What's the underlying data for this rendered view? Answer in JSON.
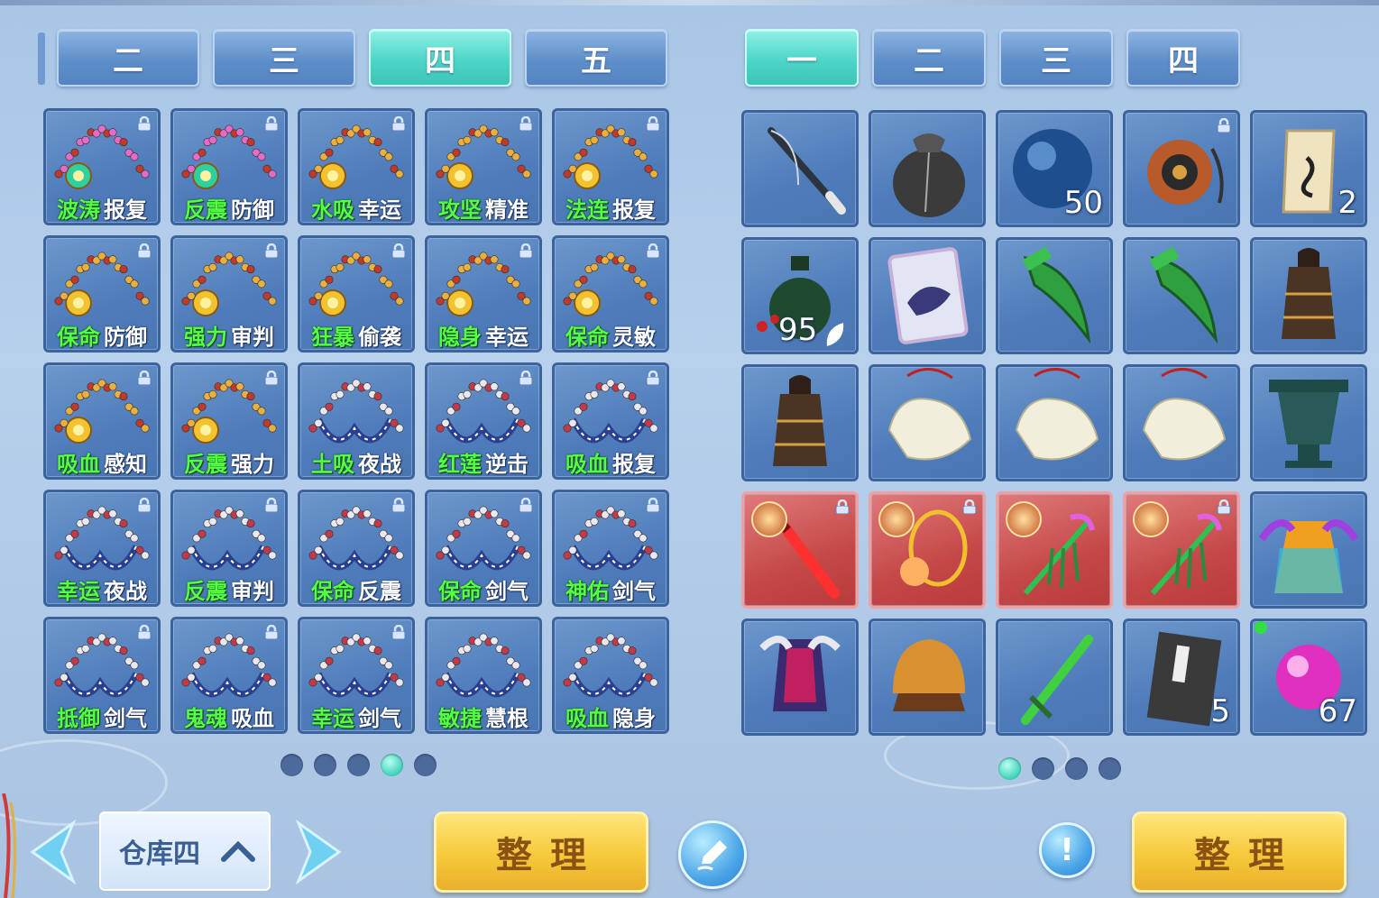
{
  "left_panel": {
    "tabs": [
      {
        "label": "二",
        "active": false
      },
      {
        "label": "三",
        "active": false
      },
      {
        "label": "四",
        "active": true
      },
      {
        "label": "五",
        "active": false
      }
    ],
    "items": [
      {
        "a": "波涛",
        "b": "报复",
        "kind": "necklace-a",
        "locked": true
      },
      {
        "a": "反震",
        "b": "防御",
        "kind": "necklace-a",
        "locked": true
      },
      {
        "a": "水吸",
        "b": "幸运",
        "kind": "necklace-b",
        "locked": true
      },
      {
        "a": "攻坚",
        "b": "精准",
        "kind": "necklace-b",
        "locked": true
      },
      {
        "a": "法连",
        "b": "报复",
        "kind": "necklace-b",
        "locked": true
      },
      {
        "a": "保命",
        "b": "防御",
        "kind": "necklace-b",
        "locked": true
      },
      {
        "a": "强力",
        "b": "审判",
        "kind": "necklace-b",
        "locked": true
      },
      {
        "a": "狂暴",
        "b": "偷袭",
        "kind": "necklace-b",
        "locked": true
      },
      {
        "a": "隐身",
        "b": "幸运",
        "kind": "necklace-b",
        "locked": true
      },
      {
        "a": "保命",
        "b": "灵敏",
        "kind": "necklace-b",
        "locked": true
      },
      {
        "a": "吸血",
        "b": "感知",
        "kind": "necklace-b",
        "locked": true
      },
      {
        "a": "反震",
        "b": "强力",
        "kind": "necklace-b",
        "locked": true
      },
      {
        "a": "土吸",
        "b": "夜战",
        "kind": "necklace-c",
        "locked": false
      },
      {
        "a": "红莲",
        "b": "逆击",
        "kind": "necklace-c",
        "locked": true
      },
      {
        "a": "吸血",
        "b": "报复",
        "kind": "necklace-c",
        "locked": true
      },
      {
        "a": "幸运",
        "b": "夜战",
        "kind": "necklace-c",
        "locked": true
      },
      {
        "a": "反震",
        "b": "审判",
        "kind": "necklace-c",
        "locked": true
      },
      {
        "a": "保命",
        "b": "反震",
        "kind": "necklace-c",
        "locked": true
      },
      {
        "a": "保命",
        "b": "剑气",
        "kind": "necklace-c",
        "locked": true
      },
      {
        "a": "神佑",
        "b": "剑气",
        "kind": "necklace-c",
        "locked": true
      },
      {
        "a": "抵御",
        "b": "剑气",
        "kind": "necklace-c",
        "locked": true
      },
      {
        "a": "鬼魂",
        "b": "吸血",
        "kind": "necklace-c",
        "locked": true
      },
      {
        "a": "幸运",
        "b": "剑气",
        "kind": "necklace-c",
        "locked": true
      },
      {
        "a": "敏捷",
        "b": "慧根",
        "kind": "necklace-c",
        "locked": false
      },
      {
        "a": "吸血",
        "b": "隐身",
        "kind": "necklace-c",
        "locked": false
      }
    ],
    "pages": 5,
    "current_page": 4,
    "warehouse_label": "仓库四",
    "sort_label": "整理"
  },
  "right_panel": {
    "tabs": [
      {
        "label": "一",
        "active": true
      },
      {
        "label": "二",
        "active": false
      },
      {
        "label": "三",
        "active": false
      },
      {
        "label": "四",
        "active": false
      }
    ],
    "items": [
      {
        "icon": "fishing-rod-icon",
        "qty": "",
        "locked": false,
        "red": false
      },
      {
        "icon": "pouch-icon",
        "qty": "",
        "locked": false,
        "red": false
      },
      {
        "icon": "blue-orb-icon",
        "qty": "50",
        "locked": false,
        "red": false
      },
      {
        "icon": "amulet-icon",
        "qty": "",
        "locked": true,
        "red": false
      },
      {
        "icon": "scroll-icon",
        "qty": "2",
        "locked": false,
        "red": false
      },
      {
        "icon": "wine-jar-icon",
        "qty": "95",
        "locked": false,
        "red": false
      },
      {
        "icon": "beast-card-icon",
        "qty": "",
        "locked": false,
        "red": false
      },
      {
        "icon": "jade-blade-icon",
        "qty": "",
        "locked": false,
        "red": false
      },
      {
        "icon": "jade-blade-icon",
        "qty": "",
        "locked": false,
        "red": false
      },
      {
        "icon": "bronze-bell-icon",
        "qty": "",
        "locked": false,
        "red": false
      },
      {
        "icon": "bronze-bell-icon",
        "qty": "",
        "locked": false,
        "red": false
      },
      {
        "icon": "jade-pendant-icon",
        "qty": "",
        "locked": false,
        "red": false
      },
      {
        "icon": "jade-pendant-icon",
        "qty": "",
        "locked": false,
        "red": false
      },
      {
        "icon": "jade-pendant-icon",
        "qty": "",
        "locked": false,
        "red": false
      },
      {
        "icon": "bronze-vessel-icon",
        "qty": "",
        "locked": false,
        "red": false
      },
      {
        "icon": "red-sword-icon",
        "qty": "",
        "locked": true,
        "red": true
      },
      {
        "icon": "gold-chain-icon",
        "qty": "",
        "locked": true,
        "red": true
      },
      {
        "icon": "green-staff-icon",
        "qty": "",
        "locked": false,
        "red": true
      },
      {
        "icon": "green-staff-icon",
        "qty": "",
        "locked": true,
        "red": true
      },
      {
        "icon": "rainbow-robe-icon",
        "qty": "",
        "locked": false,
        "red": false
      },
      {
        "icon": "ornate-armor-icon",
        "qty": "",
        "locked": false,
        "red": false
      },
      {
        "icon": "golden-helmet-icon",
        "qty": "",
        "locked": false,
        "red": false
      },
      {
        "icon": "green-sword-icon",
        "qty": "",
        "locked": false,
        "red": false
      },
      {
        "icon": "book-icon",
        "qty": "5",
        "locked": false,
        "red": false
      },
      {
        "icon": "pink-orb-icon",
        "qty": "67",
        "locked": false,
        "red": false
      }
    ],
    "pages": 4,
    "current_page": 1,
    "sort_label": "整理"
  },
  "colors": {
    "panel_bg": "#b7d0ec",
    "slot_blue": "#4e7cba",
    "slot_red": "#c54848",
    "tab_active": "#4dd6c8",
    "label_green": "#55ff44",
    "sort_button": "#f6c93a"
  }
}
